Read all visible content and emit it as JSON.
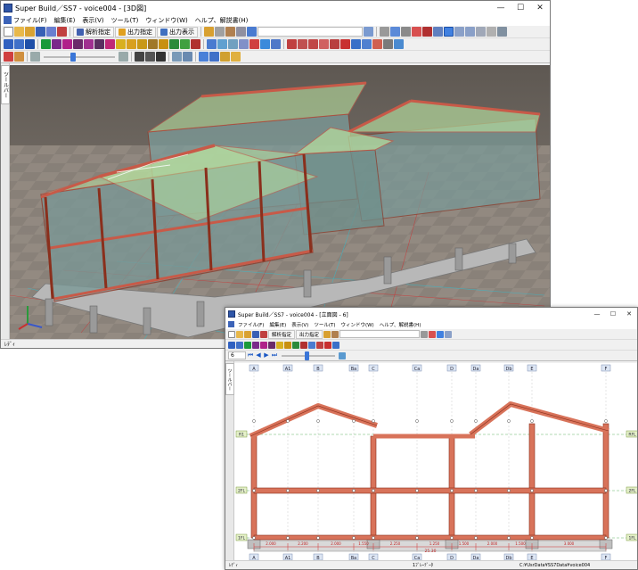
{
  "window_3d": {
    "title": "Super Build／SS7 - voice004 - [3D図]",
    "controls": {
      "minimize": "—",
      "maximize": "☐",
      "close": "✕"
    },
    "menu": [
      "ファイル(F)",
      "編集(E)",
      "表示(V)",
      "ツール(T)",
      "ウィンドウ(W)",
      "ヘルプ、解説書(H)"
    ],
    "toolbar": {
      "analysis_label": "解析指定",
      "output_spec_label": "出力指定",
      "output_view_label": "出力表示"
    },
    "sidebar_tab": "ツールバー",
    "status": "ﾚﾃﾞｨ"
  },
  "window_frame": {
    "title": "Super Build／SS7 - voice004 - [立面図 - 6]",
    "controls": {
      "minimize": "—",
      "maximize": "☐",
      "close": "✕"
    },
    "menu": [
      "ファイル(F)",
      "編集(E)",
      "表示(V)",
      "ツール(T)",
      "ウィンドウ(W)",
      "ヘルプ、解説書(H)"
    ],
    "toolbar": {
      "analysis_label": "解析指定",
      "output_spec_label": "出力指定",
      "page_value": "6"
    },
    "sidebar_tab": "ツールバー",
    "status": "ﾚﾃﾞｨ",
    "status_center": "1ﾌﾞﾚｰﾃﾞｰﾀ",
    "status_right": "C:¥UsrData¥SS7Data¥voice004"
  },
  "elevation": {
    "grid_top": [
      "A",
      "A1",
      "B",
      "Ba",
      "C",
      "Ca",
      "D",
      "Da",
      "Db",
      "E",
      "F"
    ],
    "grid_bottom": [
      "A",
      "A1",
      "B",
      "Ba",
      "C",
      "Ca",
      "D",
      "Da",
      "Db",
      "E",
      "F"
    ],
    "levels_left": [
      "R1",
      "2FL",
      "1FL"
    ],
    "levels_right": [
      "RFL",
      "2FL",
      "1FL"
    ],
    "spans": [
      "2.000",
      "2.200",
      "2.000",
      "1.550",
      "2.250",
      "1.250",
      "1.500",
      "2.000",
      "1.500",
      "3.000"
    ],
    "total_span": "25.30"
  },
  "colors": {
    "beam": "#d8735a",
    "beam_stroke": "#8a2f1c",
    "roof_glass": "#b8e0a0",
    "floor": "#8fb0a8",
    "ground": "#8a7f76"
  }
}
